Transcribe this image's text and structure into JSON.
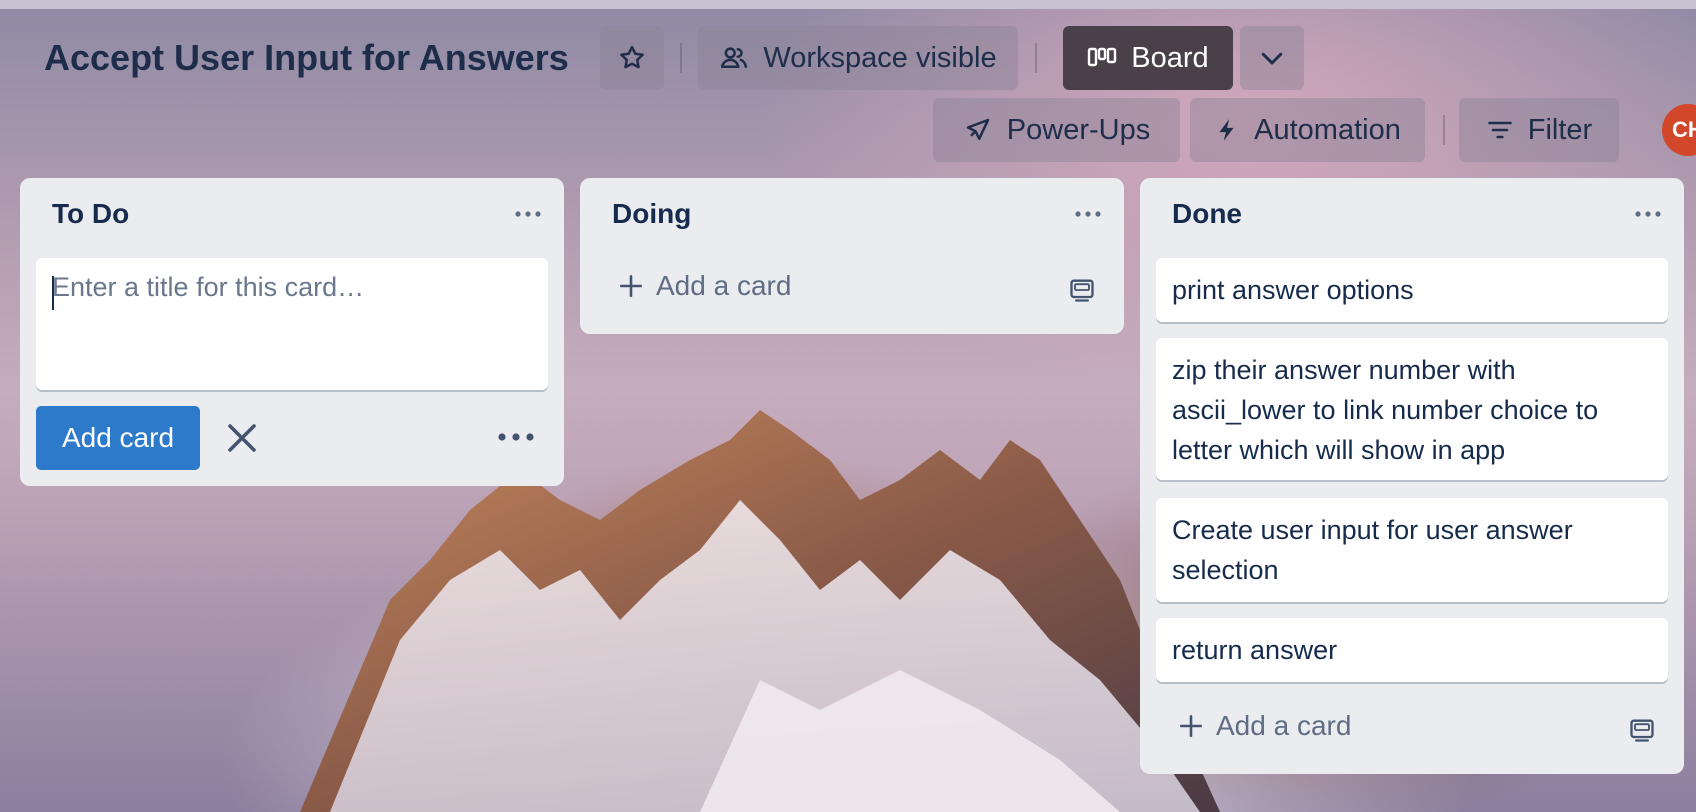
{
  "board": {
    "title": "Accept User Input for Answers",
    "visibility_label": "Workspace visible",
    "view_label": "Board",
    "powerups_label": "Power-Ups",
    "automation_label": "Automation",
    "filter_label": "Filter",
    "avatar_initials": "CH"
  },
  "lists": [
    {
      "title": "To Do",
      "composer": {
        "placeholder": "Enter a title for this card…",
        "value": "",
        "submit_label": "Add card"
      },
      "cards": []
    },
    {
      "title": "Doing",
      "add_card_label": "Add a card",
      "cards": []
    },
    {
      "title": "Done",
      "add_card_label": "Add a card",
      "cards": [
        {
          "title": "print answer options"
        },
        {
          "title": "zip their answer number with ascii_lower to link number choice to letter which will show in app"
        },
        {
          "title": "Create user input for user answer selection"
        },
        {
          "title": "return answer"
        }
      ]
    }
  ],
  "colors": {
    "accent_button": "#2c7ac9",
    "list_bg": "#ebecf0",
    "avatar": "#d2472a",
    "view_button": "#4a4049"
  },
  "icons": {
    "star": "star-icon",
    "visibility": "people-icon",
    "board": "board-icon",
    "dropdown": "chevron-down-icon",
    "powerups": "rocket-icon",
    "automation": "lightning-icon",
    "filter": "filter-icon",
    "list_menu": "ellipsis-icon",
    "template": "card-template-icon",
    "close": "close-icon",
    "add": "plus-icon"
  }
}
